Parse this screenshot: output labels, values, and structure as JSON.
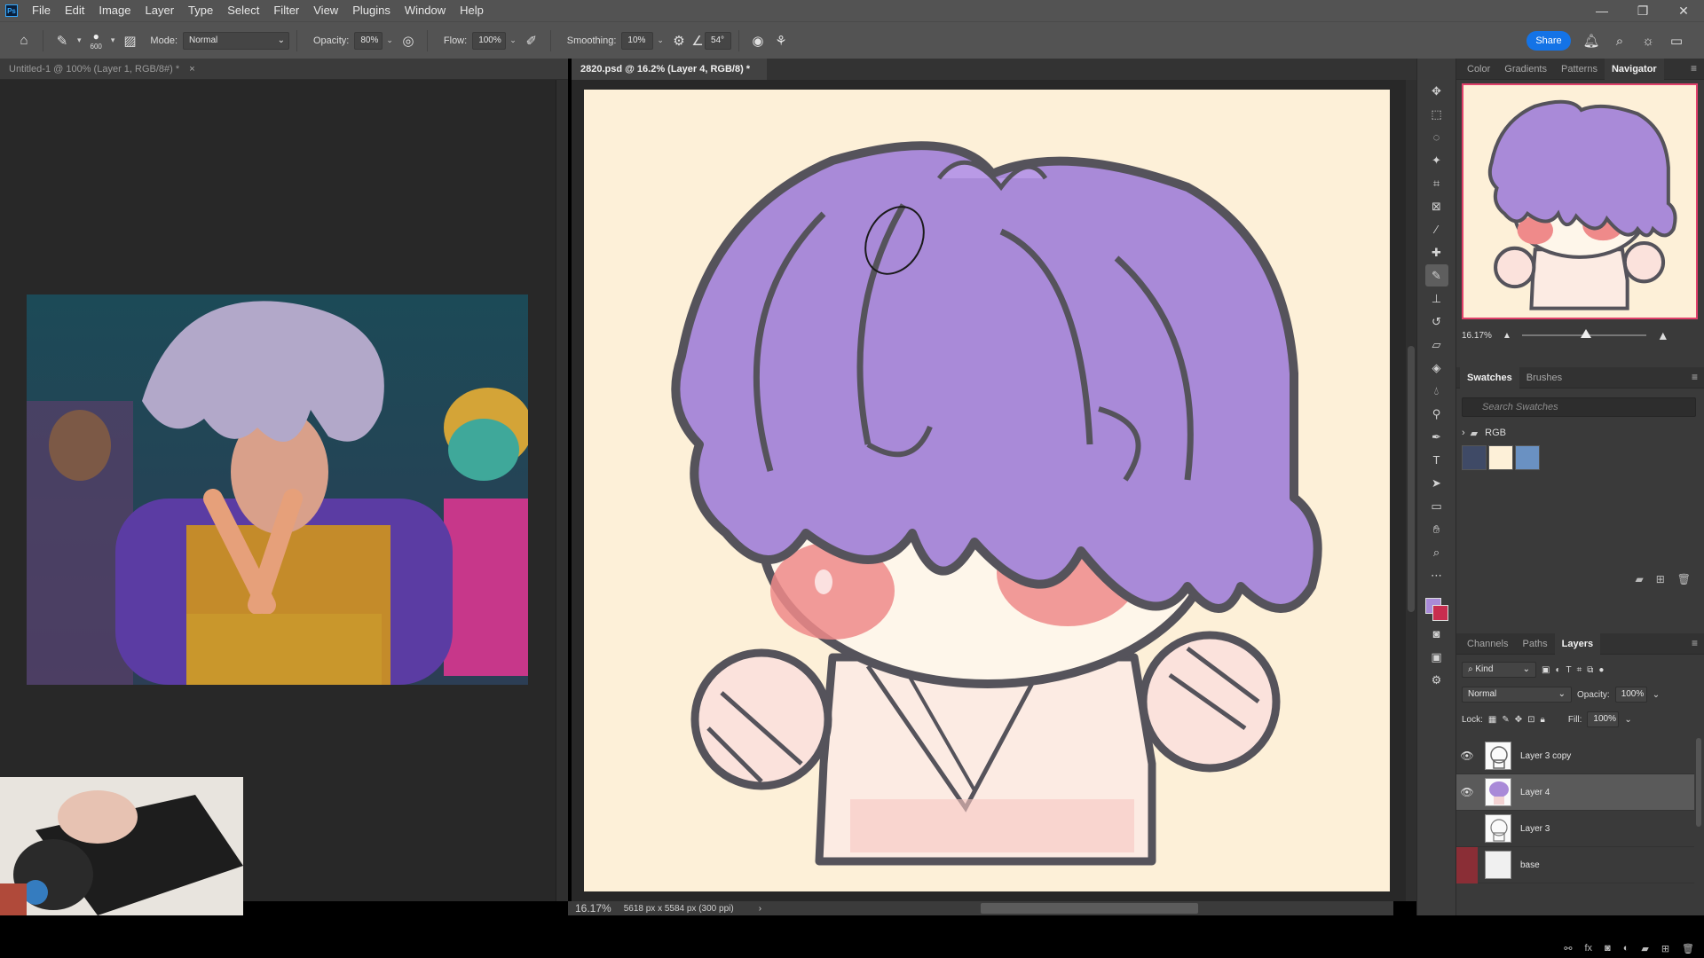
{
  "app": {
    "logo_text": "Ps",
    "menu": [
      "File",
      "Edit",
      "Image",
      "Layer",
      "Type",
      "Select",
      "Filter",
      "View",
      "Plugins",
      "Window",
      "Help"
    ],
    "window_controls": [
      "—",
      "❐",
      "✕"
    ]
  },
  "options": {
    "brush_size": "600",
    "mode_label": "Mode:",
    "mode_value": "Normal",
    "opacity_label": "Opacity:",
    "opacity_value": "80%",
    "flow_label": "Flow:",
    "flow_value": "100%",
    "smoothing_label": "Smoothing:",
    "smoothing_value": "10%",
    "angle_value": "54°",
    "share_label": "Share"
  },
  "tabs": {
    "left": "Untitled-1 @ 100% (Layer 1, RGB/8#) *",
    "right": "2820.psd @ 16.2% (Layer 4, RGB/8) *",
    "close": "×"
  },
  "status": {
    "zoom": "16.17%",
    "doc_info": "5618 px x 5584 px (300 ppi)",
    "arrow": "›"
  },
  "panels": {
    "top_tabs": [
      "Color",
      "Gradients",
      "Patterns",
      "Navigator"
    ],
    "active_top_tab": "Navigator",
    "navigator_zoom": "16.17%",
    "mid_tabs": [
      "Swatches",
      "Brushes"
    ],
    "swatch_search_placeholder": "Search Swatches",
    "swatch_group": "RGB",
    "swatch_colors": [
      "#3f4a66",
      "#fdf0d8",
      "#6a91c2"
    ],
    "bottom_tabs": [
      "Channels",
      "Paths",
      "Layers"
    ],
    "kind_label": "Kind",
    "blend_mode": "Normal",
    "opacity_label": "Opacity:",
    "opacity_value": "100%",
    "lock_label": "Lock:",
    "fill_label": "Fill:",
    "fill_value": "100%"
  },
  "layers": [
    {
      "name": "Layer 3 copy",
      "visible": true,
      "selected": false
    },
    {
      "name": "Layer 4",
      "visible": true,
      "selected": true
    },
    {
      "name": "Layer 3",
      "visible": false,
      "selected": false
    },
    {
      "name": "base",
      "visible": false,
      "selected": false
    }
  ],
  "colors": {
    "accent": "#1473e6",
    "canvas_bg": "#fdf0d8",
    "hair": "#a98ad8",
    "blush": "#ef8a8a",
    "outline": "#55535b",
    "fg_color": "#a98ad8",
    "bg_color": "#c82d4f"
  }
}
